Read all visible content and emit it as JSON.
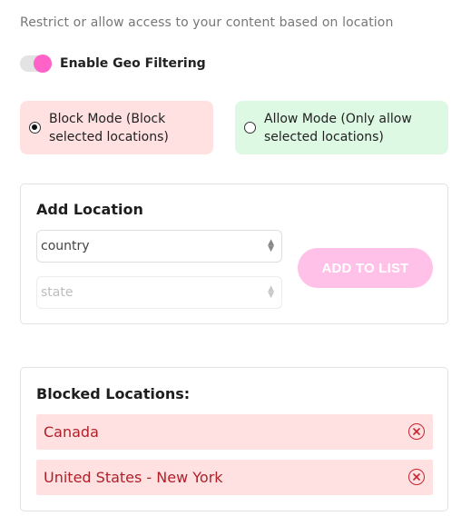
{
  "description": "Restrict or allow access to your content based on location",
  "geo_toggle": {
    "label": "Enable Geo Filtering",
    "enabled": true,
    "accent": "#ff63c8"
  },
  "modes": {
    "block": {
      "label": "Block Mode (Block selected locations)",
      "selected": true,
      "color": "#ffe1e1"
    },
    "allow": {
      "label": "Allow Mode (Only allow selected locations)",
      "selected": false,
      "color": "#ddf9e3"
    }
  },
  "add_location": {
    "title": "Add Location",
    "country_select": {
      "value": "country"
    },
    "state_select": {
      "value": "state"
    },
    "add_button": "ADD TO LIST"
  },
  "blocked": {
    "title": "Blocked Locations:",
    "items": [
      {
        "name": "Canada"
      },
      {
        "name": "United States - New York"
      }
    ]
  },
  "icons": {
    "remove": "close-circle-icon",
    "select_arrows": "chevron-up-down-icon"
  }
}
